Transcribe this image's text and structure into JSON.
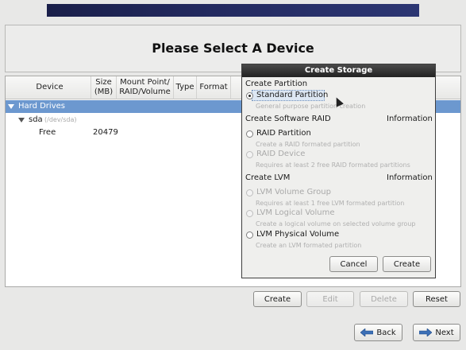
{
  "header": {
    "title": "Please Select A Device"
  },
  "table": {
    "columns": [
      "Device",
      "Size\n(MB)",
      "Mount Point/\nRAID/Volume",
      "Type",
      "Format"
    ],
    "rows": {
      "hard_drives": "Hard Drives",
      "sda": "sda",
      "sda_path": "(/dev/sda)",
      "free_label": "Free",
      "free_size": "20479"
    }
  },
  "dialog": {
    "title": "Create Storage",
    "create_partition": "Create Partition",
    "standard_partition": "Standard Partition",
    "standard_partition_desc": "General purpose partition creation",
    "create_software_raid": "Create Software RAID",
    "information_raid": "Information",
    "raid_partition": "RAID Partition",
    "raid_partition_desc": "Create a RAID formated partition",
    "raid_device": "RAID Device",
    "raid_device_desc": "Requires at least 2 free RAID formated partitions",
    "create_lvm": "Create LVM",
    "information_lvm": "Information",
    "lvm_volume_group": "LVM Volume Group",
    "lvm_volume_group_desc": "Requires at least 1 free LVM formated partition",
    "lvm_logical_volume": "LVM Logical Volume",
    "lvm_logical_volume_desc": "Create a logical volume on selected volume group",
    "lvm_physical_volume": "LVM Physical Volume",
    "lvm_physical_volume_desc": "Create an LVM formated partition",
    "cancel": "Cancel",
    "create": "Create"
  },
  "actions": {
    "create": "Create",
    "edit": "Edit",
    "delete": "Delete",
    "reset": "Reset"
  },
  "nav": {
    "back": "Back",
    "next": "Next"
  },
  "colors": {
    "selection": "#6c98cf",
    "banner": "#232a60"
  }
}
